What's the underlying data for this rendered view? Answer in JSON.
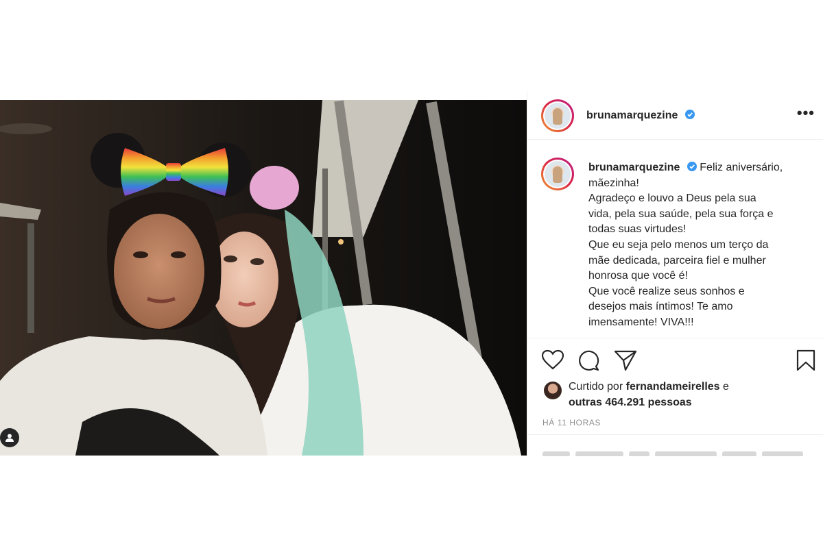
{
  "post": {
    "username": "brunamarquezine",
    "more_label": "•••",
    "caption": {
      "username": "brunamarquezine",
      "text_lines": [
        "Feliz aniversário,",
        "mãezinha!",
        "Agradeço e louvo a Deus pela sua",
        "vida, pela sua saúde, pela sua força e",
        "todas suas virtudes!",
        "Que eu seja pelo menos um terço da",
        "mãe dedicada, parceira fiel e mulher",
        "honrosa que você é!",
        "Que você realize seus sonhos e",
        "desejos mais íntimos! Te amo",
        "imensamente! VIVA!!!"
      ]
    },
    "likes": {
      "prefix": "Curtido por",
      "liker": "fernandameirelles",
      "conjunction": "e",
      "others": "outras 464.291 pessoas"
    },
    "timestamp": "HÁ 11 HORAS",
    "icons": {
      "like": "heart-icon",
      "comment": "comment-icon",
      "share": "paper-plane-icon",
      "save": "bookmark-icon",
      "verified": "verified-badge-icon",
      "tag": "user-tag-icon"
    },
    "colors": {
      "verified": "#3897f0",
      "text": "#262626",
      "muted": "#8e8e8e",
      "divider": "#efefef"
    }
  }
}
